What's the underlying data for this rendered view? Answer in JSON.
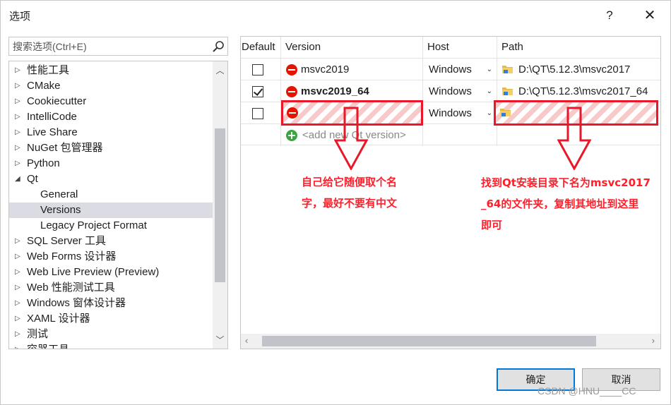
{
  "window": {
    "title": "选项",
    "help": "?",
    "close": "✕"
  },
  "search": {
    "placeholder": "搜索选项(Ctrl+E)"
  },
  "tree": {
    "items": [
      {
        "label": "性能工具",
        "arrow": "▷",
        "level": 0
      },
      {
        "label": "CMake",
        "arrow": "▷",
        "level": 0
      },
      {
        "label": "Cookiecutter",
        "arrow": "▷",
        "level": 0
      },
      {
        "label": "IntelliCode",
        "arrow": "▷",
        "level": 0
      },
      {
        "label": "Live Share",
        "arrow": "▷",
        "level": 0
      },
      {
        "label": "NuGet 包管理器",
        "arrow": "▷",
        "level": 0
      },
      {
        "label": "Python",
        "arrow": "▷",
        "level": 0
      },
      {
        "label": "Qt",
        "arrow": "◢",
        "level": 0
      },
      {
        "label": "General",
        "arrow": "",
        "level": 1
      },
      {
        "label": "Versions",
        "arrow": "",
        "level": 1,
        "selected": true
      },
      {
        "label": "Legacy Project Format",
        "arrow": "",
        "level": 1
      },
      {
        "label": "SQL Server 工具",
        "arrow": "▷",
        "level": 0
      },
      {
        "label": "Web Forms 设计器",
        "arrow": "▷",
        "level": 0
      },
      {
        "label": "Web Live Preview (Preview)",
        "arrow": "▷",
        "level": 0
      },
      {
        "label": "Web 性能测试工具",
        "arrow": "▷",
        "level": 0
      },
      {
        "label": "Windows 窗体设计器",
        "arrow": "▷",
        "level": 0
      },
      {
        "label": "XAML 设计器",
        "arrow": "▷",
        "level": 0
      },
      {
        "label": "测试",
        "arrow": "▷",
        "level": 0
      },
      {
        "label": "容器工具",
        "arrow": "▷",
        "level": 0
      }
    ]
  },
  "grid": {
    "columns": [
      "Default",
      "Version",
      "Host",
      "Path"
    ],
    "rows": [
      {
        "checked": false,
        "version": "msvc2019",
        "bold": false,
        "host": "Windows",
        "path": "D:\\QT\\5.12.3\\msvc2017"
      },
      {
        "checked": true,
        "version": "msvc2019_64",
        "bold": true,
        "host": "Windows",
        "path": "D:\\QT\\5.12.3\\msvc2017_64"
      },
      {
        "checked": false,
        "version": "",
        "bold": false,
        "host": "Windows",
        "path": ""
      }
    ],
    "add_row": "<add new Qt version>"
  },
  "annotations": {
    "note_left": [
      "自己给它随便取个名",
      "字，最好不要有中文"
    ],
    "note_right": [
      "找到Qt安装目录下名为msvc2017",
      "_64的文件夹，复制其地址到这里",
      "即可"
    ],
    "accent": "#e8182a"
  },
  "buttons": {
    "ok": "确定",
    "cancel": "取消"
  },
  "watermark": "CSDN @HNU____CC"
}
